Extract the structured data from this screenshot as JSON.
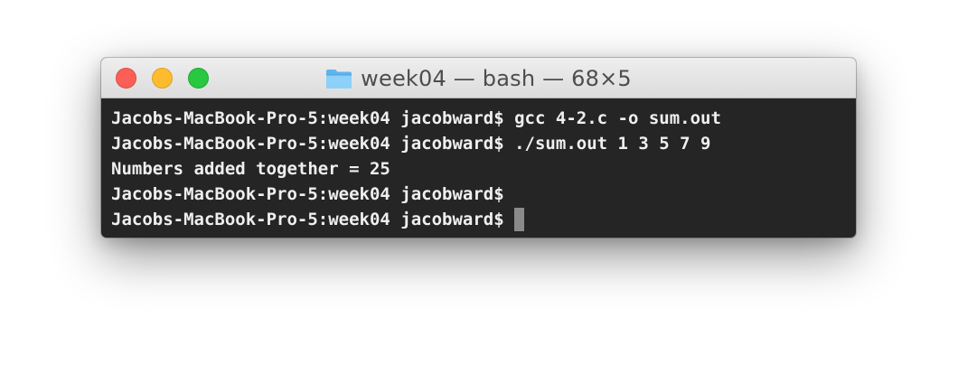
{
  "window": {
    "title": "week04 — bash — 68×5"
  },
  "titlebar": {
    "buttons": [
      "close",
      "minimize",
      "zoom"
    ],
    "icon": "folder-icon"
  },
  "terminal": {
    "lines": [
      "Jacobs-MacBook-Pro-5:week04 jacobward$ gcc 4-2.c -o sum.out",
      "Jacobs-MacBook-Pro-5:week04 jacobward$ ./sum.out 1 3 5 7 9",
      "Numbers added together = 25",
      "Jacobs-MacBook-Pro-5:week04 jacobward$",
      "Jacobs-MacBook-Pro-5:week04 jacobward$ "
    ]
  },
  "colors": {
    "terminal_background": "#252525",
    "terminal_text": "#efefef",
    "cursor": "#8a8a8a",
    "close": "#fc5f57",
    "minimize": "#fdbc2e",
    "zoom": "#28c840"
  }
}
